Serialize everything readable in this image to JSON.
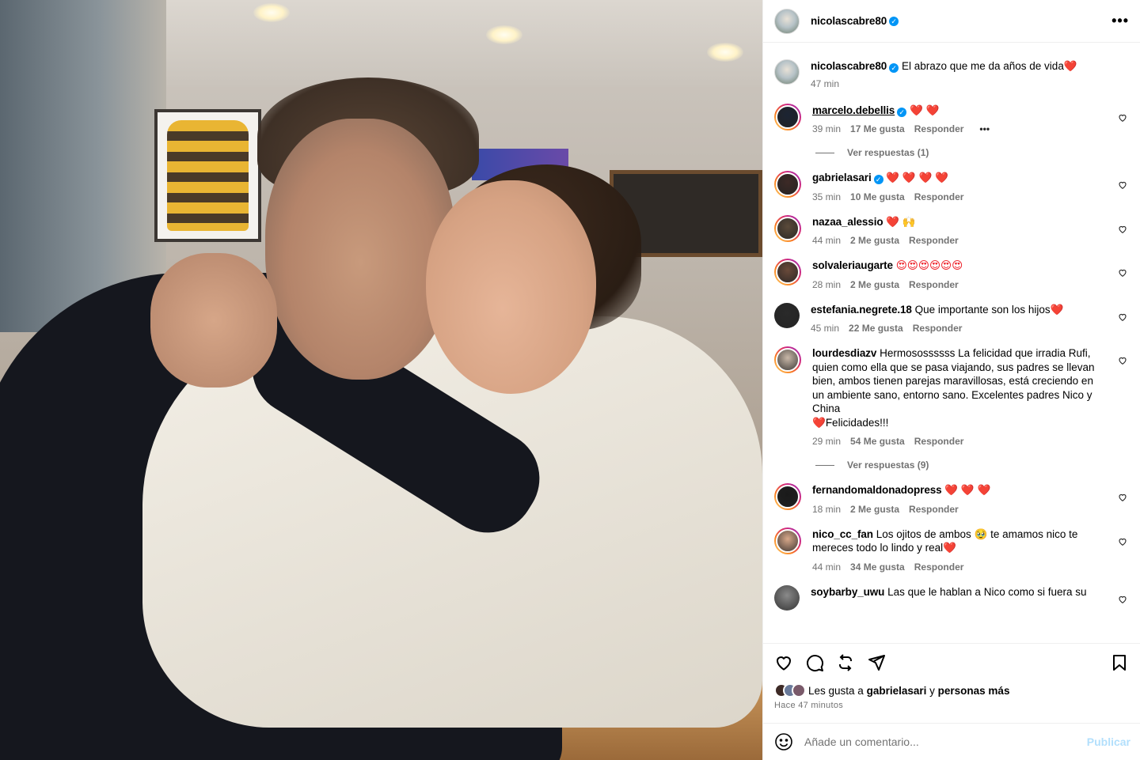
{
  "post": {
    "author": "nicolascabre80",
    "caption": "El abrazo que me da años de vida",
    "caption_time": "47 min",
    "more_label": "•••"
  },
  "comments": [
    {
      "user": "marcelo.debellis",
      "verified": true,
      "text": "",
      "emoji": "❤️ ❤️",
      "time": "39 min",
      "likes": "17 Me gusta",
      "reply": "Responder",
      "more": "•••",
      "avatar_color": "#1c2433",
      "has_views": true,
      "views": "Ver respuestas (1)",
      "ring": true
    },
    {
      "user": "gabrielasari",
      "verified": true,
      "text": "",
      "emoji": "❤️ ❤️ ❤️ ❤️",
      "time": "35 min",
      "likes": "10 Me gusta",
      "reply": "Responder",
      "avatar_color": "#3d2a26",
      "ring": true
    },
    {
      "user": "nazaa_alessio",
      "verified": false,
      "text": "",
      "emoji": "❤️ 🙌",
      "time": "44 min",
      "likes": "2 Me gusta",
      "reply": "Responder",
      "avatar_color": "#5b4a3a",
      "ring": true
    },
    {
      "user": "solvaleriaugarte",
      "verified": false,
      "text": "",
      "emoji": "😍😍😍😍😍😍",
      "time": "28 min",
      "likes": "2 Me gusta",
      "reply": "Responder",
      "avatar_color": "#6a4a3a",
      "ring": true
    },
    {
      "user": "estefania.negrete.18",
      "verified": false,
      "text": "Que importante son los hijos",
      "emoji": "❤️",
      "time": "45 min",
      "likes": "22 Me gusta",
      "reply": "Responder",
      "avatar_color": "#2a2a2a",
      "ring": false
    },
    {
      "user": "lourdesdiazv",
      "verified": false,
      "text": "Hermosossssss La felicidad que irradia Rufi, quien como ella que se pasa viajando, sus padres se llevan bien, ambos tienen parejas maravillosas, está creciendo en un ambiente sano, entorno sano. Excelentes padres Nico y China",
      "text2": "Felicidades!!!",
      "emoji": "❤️",
      "time": "29 min",
      "likes": "54 Me gusta",
      "reply": "Responder",
      "avatar_color": "#c9b8a8",
      "has_views": true,
      "views": "Ver respuestas (9)",
      "ring": true
    },
    {
      "user": "fernandomaldonadopress",
      "verified": false,
      "text": "",
      "emoji": "❤️ ❤️ ❤️",
      "time": "18 min",
      "likes": "2 Me gusta",
      "reply": "Responder",
      "avatar_color": "#1a1a1a",
      "ring": true
    },
    {
      "user": "nico_cc_fan",
      "verified": false,
      "text": "Los ojitos de ambos 🥹 te amamos nico te mereces todo lo lindo y real",
      "emoji": "❤️",
      "time": "44 min",
      "likes": "34 Me gusta",
      "reply": "Responder",
      "avatar_color": "#d8a88a",
      "ring": true
    },
    {
      "user": "soybarby_uwu",
      "verified": false,
      "text": "Las que le hablan a Nico como si fuera su",
      "emoji": "",
      "time": "",
      "likes": "",
      "reply": "",
      "avatar_color": "#8a8a8a",
      "ring": false
    }
  ],
  "likes_bar": {
    "prefix": "Les gusta a",
    "user": "gabrielasari",
    "middle": "y",
    "suffix": "personas más",
    "time": "Hace 47 minutos"
  },
  "composer": {
    "placeholder": "Añade un comentario...",
    "post_label": "Publicar"
  },
  "icons": [
    "heart-icon",
    "comment-icon",
    "repost-icon",
    "share-icon",
    "bookmark-icon",
    "emoji-icon",
    "verified-icon"
  ]
}
